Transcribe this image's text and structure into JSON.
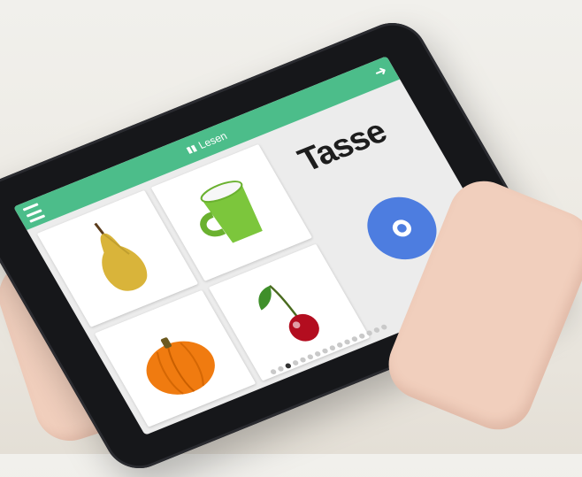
{
  "app": {
    "title": "Lesen",
    "menu_icon": "hamburger-menu-icon",
    "next_icon": "arrow-right-icon",
    "header_color": "#4cbd8a"
  },
  "prompt": {
    "word": "Tasse"
  },
  "cards": [
    {
      "name": "pear",
      "label": "pear-image"
    },
    {
      "name": "cup",
      "label": "cup-image"
    },
    {
      "name": "pumpkin",
      "label": "pumpkin-image"
    },
    {
      "name": "cherry",
      "label": "cherry-image"
    }
  ],
  "controls": {
    "audio_button_icon": "speaker-icon",
    "audio_button_color": "#4d7de0"
  },
  "pagination": {
    "dot_count": 16,
    "active_index": 2
  }
}
